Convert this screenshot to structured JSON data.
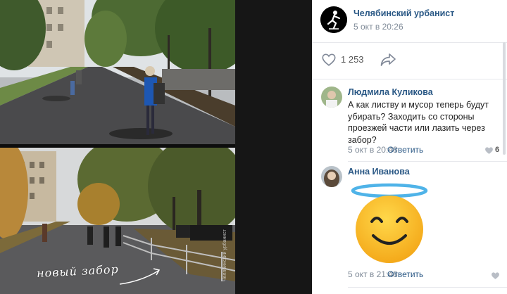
{
  "photo": {
    "caption": "новый забор",
    "watermark": "Челябинский урбанист"
  },
  "post": {
    "group_name": "Челябинский урбанист",
    "date": "5 окт в 20:26",
    "likes_count": "1 253",
    "icons": {
      "avatar": "skater-silhouette-icon",
      "like": "heart-icon",
      "share": "share-arrow-icon"
    }
  },
  "comments": [
    {
      "author": "Людмила Куликова",
      "text": "А как листву и мусор теперь будут убирать? Заходить со стороны проезжей части или лазить через забор?",
      "date": "5 окт в 20:48",
      "reply_label": "Ответить",
      "likes": "6"
    },
    {
      "author": "Анна Иванова",
      "sticker": "angel-smile-emoji",
      "date": "5 окт в 21:48",
      "reply_label": "Ответить",
      "likes": ""
    }
  ],
  "colors": {
    "link": "#2a5885",
    "muted": "#818c99",
    "divider": "#e7e8ec"
  }
}
